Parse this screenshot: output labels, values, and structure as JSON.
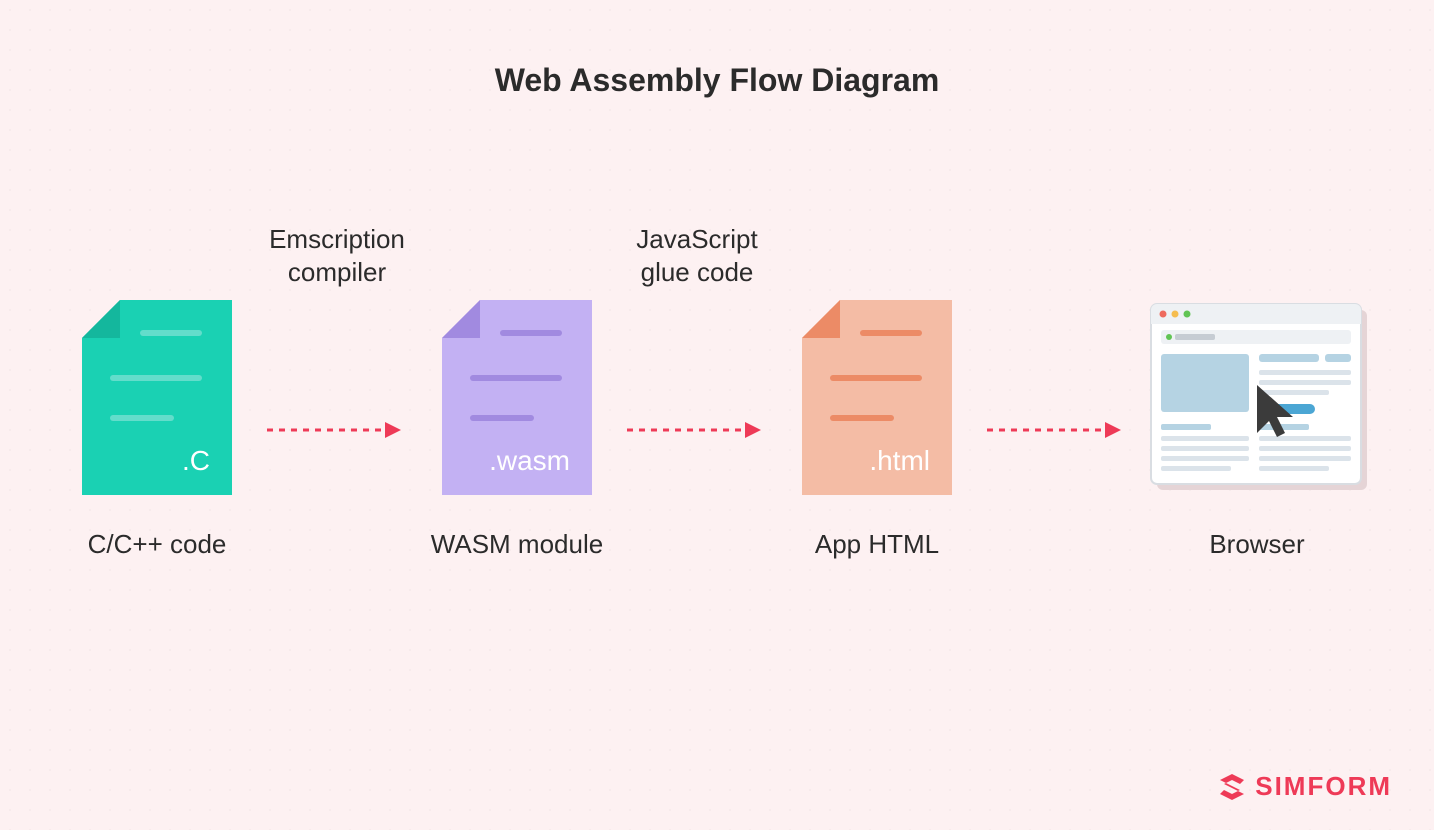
{
  "title": "Web Assembly Flow Diagram",
  "nodes": [
    {
      "ext": ".C",
      "label": "C/C++ code",
      "color": "#1ad1b3",
      "fold": "#14b79d",
      "line": "#63ddcb"
    },
    {
      "ext": ".wasm",
      "label": "WASM module",
      "color": "#c3b1f3",
      "fold": "#a18ae0",
      "line": "#a18ae0"
    },
    {
      "ext": ".html",
      "label": "App HTML",
      "color": "#f4bca5",
      "fold": "#ec8b66",
      "line": "#ec8b66"
    },
    {
      "ext": "",
      "label": "Browser",
      "color": "",
      "fold": "",
      "line": ""
    }
  ],
  "arrows": [
    {
      "label_l1": "Emscription",
      "label_l2": "compiler"
    },
    {
      "label_l1": "JavaScript",
      "label_l2": "glue code"
    },
    {
      "label_l1": "",
      "label_l2": ""
    }
  ],
  "logo": "SIMFORM"
}
